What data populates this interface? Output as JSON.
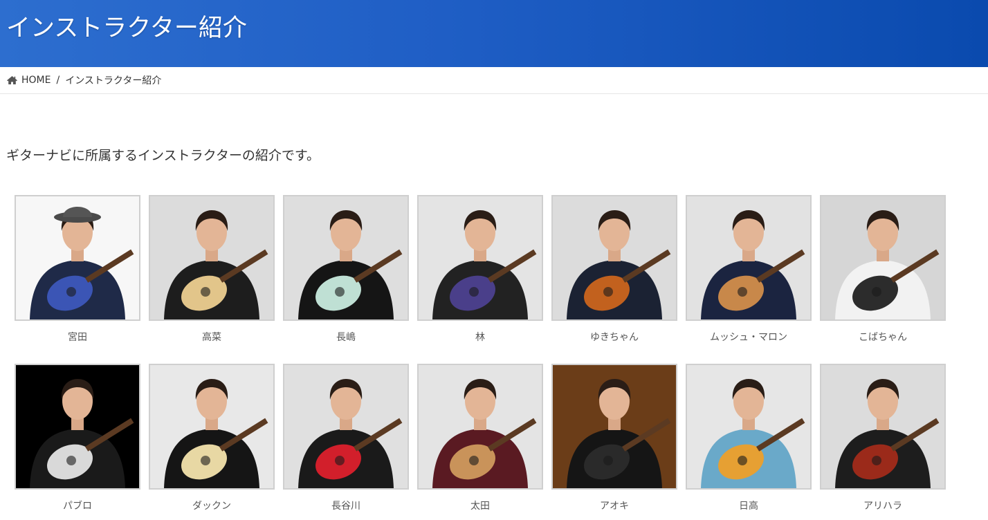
{
  "header": {
    "title": "インストラクター紹介",
    "gradient_start": "#2d6ecf",
    "gradient_end": "#0a4aae"
  },
  "breadcrumb": {
    "home_label": "HOME",
    "separator": "/",
    "current": "インストラクター紹介",
    "home_icon": "home-icon"
  },
  "intro_text": "ギターナビに所属するインストラクターの紹介です。",
  "instructors": [
    {
      "name": "宮田",
      "bg": "#f7f7f7",
      "shirt": "#1f2a48",
      "guitar": "#3b55b5",
      "hat": true
    },
    {
      "name": "高菜",
      "bg": "#dcdcdc",
      "shirt": "#1d1d1d",
      "guitar": "#e2c58a",
      "hat": false
    },
    {
      "name": "長嶋",
      "bg": "#dedede",
      "shirt": "#151515",
      "guitar": "#bfe0d4",
      "hat": false
    },
    {
      "name": "林",
      "bg": "#e4e4e4",
      "shirt": "#222222",
      "guitar": "#4a3f8a",
      "hat": false
    },
    {
      "name": "ゆきちゃん",
      "bg": "#dcdcdc",
      "shirt": "#1b2233",
      "guitar": "#c2611e",
      "hat": false
    },
    {
      "name": "ムッシュ・マロン",
      "bg": "#e2e2e2",
      "shirt": "#1b2440",
      "guitar": "#c8884a",
      "hat": false
    },
    {
      "name": "こばちゃん",
      "bg": "#d6d6d6",
      "shirt": "#f2f2f2",
      "guitar": "#2c2c2c",
      "hat": false
    },
    {
      "name": "パブロ",
      "bg": "#000000",
      "shirt": "#1a1a1a",
      "guitar": "#d9d9d9",
      "hat": false
    },
    {
      "name": "ダックン",
      "bg": "#e8e8e8",
      "shirt": "#151515",
      "guitar": "#e8d8a4",
      "hat": false
    },
    {
      "name": "長谷川",
      "bg": "#e0e0e0",
      "shirt": "#1a1a1a",
      "guitar": "#d21f2b",
      "hat": false
    },
    {
      "name": "太田",
      "bg": "#e4e4e4",
      "shirt": "#5a1a22",
      "guitar": "#c9935a",
      "hat": false
    },
    {
      "name": "アオキ",
      "bg": "#6b3d18",
      "shirt": "#151515",
      "guitar": "#2a2a2a",
      "hat": false
    },
    {
      "name": "日高",
      "bg": "#e6e6e6",
      "shirt": "#6aa9c9",
      "guitar": "#e6a033",
      "hat": false
    },
    {
      "name": "アリハラ",
      "bg": "#dcdcdc",
      "shirt": "#1d1d1d",
      "guitar": "#9b2a1a",
      "hat": false
    }
  ]
}
